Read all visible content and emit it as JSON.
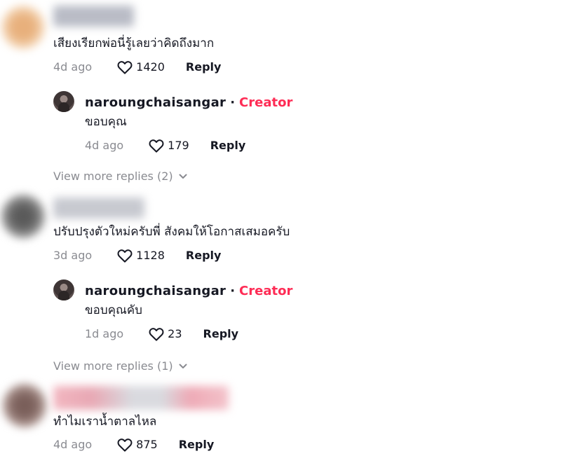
{
  "comments": [
    {
      "text": "เสียงเรียกพ่อนี่รู้เลยว่าคิดถึงมาก",
      "time": "4d ago",
      "likes": "1420",
      "reply_label": "Reply",
      "avatar_color": "#e9b98a",
      "reply": {
        "username": "naroungchaisangar",
        "dot": "·",
        "badge": "Creator",
        "text": "ขอบคุณ",
        "time": "4d ago",
        "likes": "179",
        "reply_label": "Reply"
      },
      "view_more": "View more replies (2)"
    },
    {
      "text": "ปรับปรุงตัวใหม่ครับพี่ สังคมให้โอกาสเสมอครับ",
      "time": "3d ago",
      "likes": "1128",
      "reply_label": "Reply",
      "avatar_color": "#6b6b6b",
      "reply": {
        "username": "naroungchaisangar",
        "dot": "·",
        "badge": "Creator",
        "text": "ขอบคุณคับ",
        "time": "1d ago",
        "likes": "23",
        "reply_label": "Reply"
      },
      "view_more": "View more replies (1)"
    },
    {
      "text": "ทำไมเราน้ำตาลไหล",
      "time": "4d ago",
      "likes": "875",
      "reply_label": "Reply",
      "avatar_color": "#8a6f6a"
    }
  ],
  "colors": {
    "creator_badge": "#fe2c55",
    "muted": "#8a8b91",
    "text": "#161823"
  }
}
